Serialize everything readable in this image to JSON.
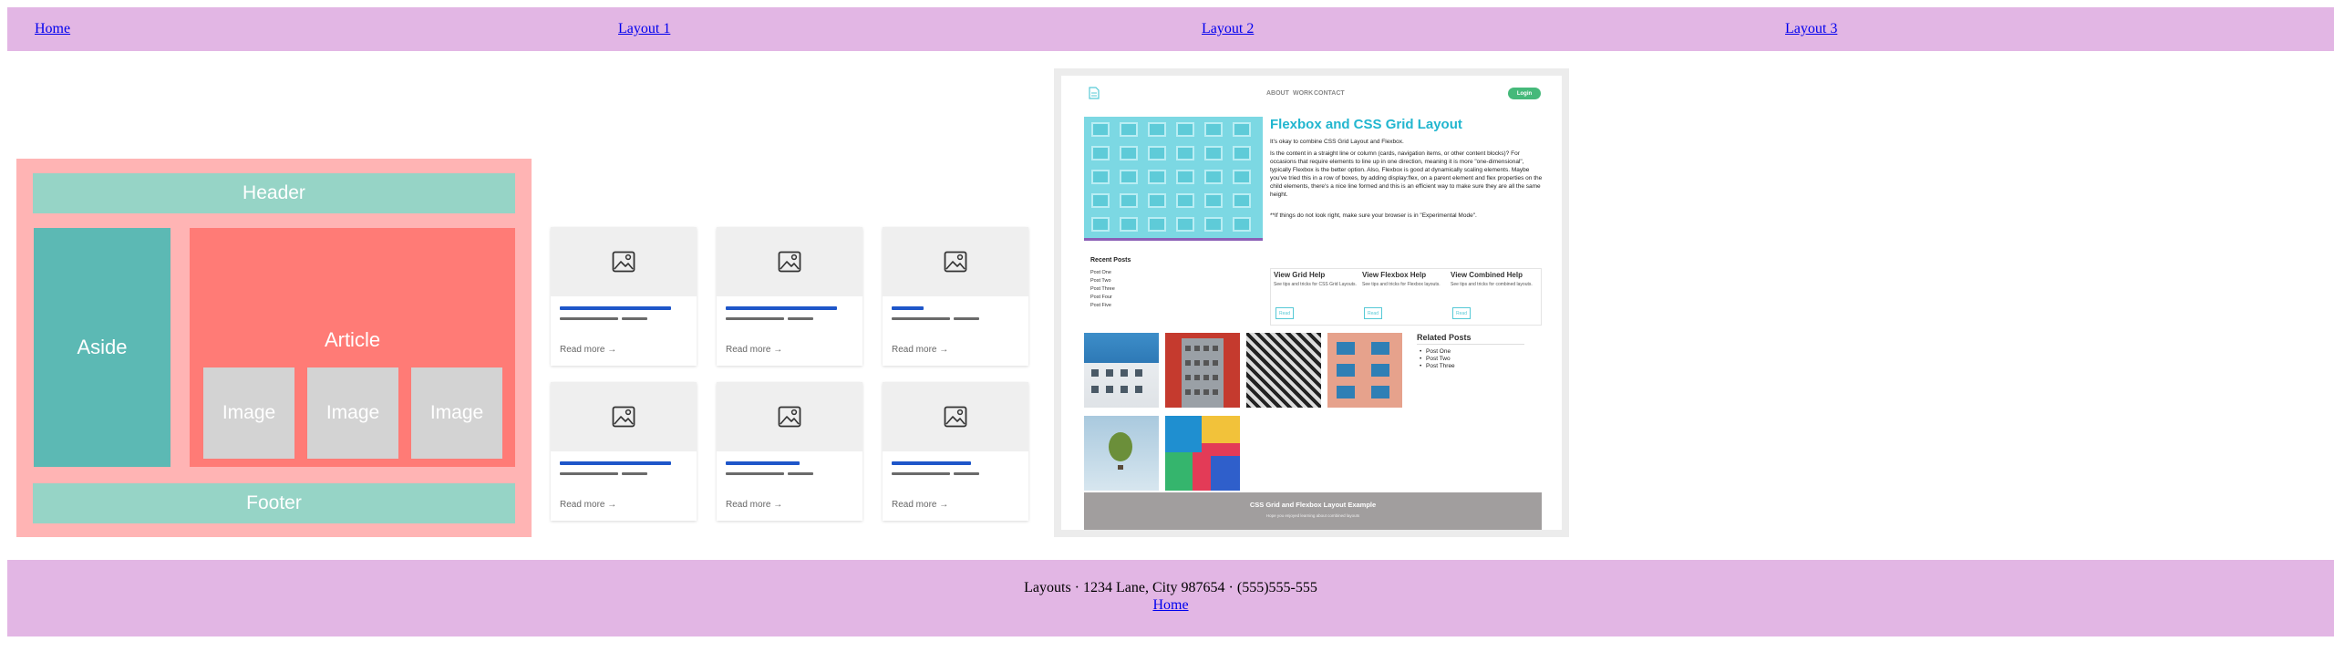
{
  "nav": {
    "items": [
      {
        "label": "Home"
      },
      {
        "label": "Layout 1"
      },
      {
        "label": "Layout 2"
      },
      {
        "label": "Layout 3"
      }
    ]
  },
  "layout_diagram": {
    "header": "Header",
    "aside": "Aside",
    "article": "Article",
    "images": [
      "Image",
      "Image",
      "Image"
    ],
    "footer": "Footer"
  },
  "cards": {
    "read_more": "Read more →",
    "items": [
      {
        "title_fill": 0.87,
        "meta_fill": [
          0.46,
          0.2
        ]
      },
      {
        "title_fill": 0.87,
        "meta_fill": [
          0.46,
          0.2
        ]
      },
      {
        "title_fill": 0.25,
        "meta_fill": [
          0.46,
          0.2
        ]
      },
      {
        "title_fill": 0.87,
        "meta_fill": [
          0.46,
          0.2
        ]
      },
      {
        "title_fill": 0.58,
        "meta_fill": [
          0.46,
          0.2
        ]
      },
      {
        "title_fill": 0.62,
        "meta_fill": [
          0.46,
          0.2
        ]
      }
    ]
  },
  "screenshot": {
    "nav": [
      "ABOUT",
      "WORK",
      "CONTACT"
    ],
    "login": "Login",
    "title": "Flexbox and CSS Grid Layout",
    "paragraphs": [
      "It's okay to combine CSS Grid Layout and Flexbox.",
      "Is the content in a straight line or column (cards, navigation items, or other content blocks)? For occasions that require elements to line up in one direction, meaning it is more \"one-dimensional\", typically Flexbox is the better option. Also, Flexbox is good at dynamically scaling elements. Maybe you've tried this in a row of boxes, by adding display:flex, on a parent element and flex properties on the child elements, there's a nice line formed and this is an efficient way to make sure they are all the same height.",
      "**If things do not look right, make sure your browser is in \"Experimental Mode\"."
    ],
    "recent_title": "Recent Posts",
    "recent_posts": [
      "Post One",
      "Post Two",
      "Post Three",
      "Post Four",
      "Post Five"
    ],
    "help": [
      {
        "title": "View Grid Help",
        "desc": "See tips and tricks for CSS Grid Layouts.",
        "btn": "Read"
      },
      {
        "title": "View Flexbox Help",
        "desc": "See tips and tricks for Flexbox layouts.",
        "btn": "Read"
      },
      {
        "title": "View Combined Help",
        "desc": "See tips and tricks for combined layouts.",
        "btn": "Read"
      }
    ],
    "related_title": "Related Posts",
    "related_posts": [
      "Post One",
      "Post Two",
      "Post Three"
    ],
    "footer_title": "CSS Grid and Flexbox Layout Example",
    "footer_sub": "Hope you enjoyed learning about combined layouts",
    "colors": {
      "accent": "#22b6cf",
      "login": "#45b97a",
      "rule": "#8b5fb6"
    }
  },
  "footer": {
    "address": "Layouts · 1234 Lane, City 987654 · (555)555-555",
    "link": "Home"
  },
  "colors": {
    "nav_bg": "#e2b6e4",
    "diagram_bg": "#ffb4b4",
    "header_footer": "#96d4c6",
    "aside": "#5cb9b4",
    "article": "#ff7b76",
    "image": "#d3d3d3",
    "card_title_bar": "#1e56c9"
  }
}
